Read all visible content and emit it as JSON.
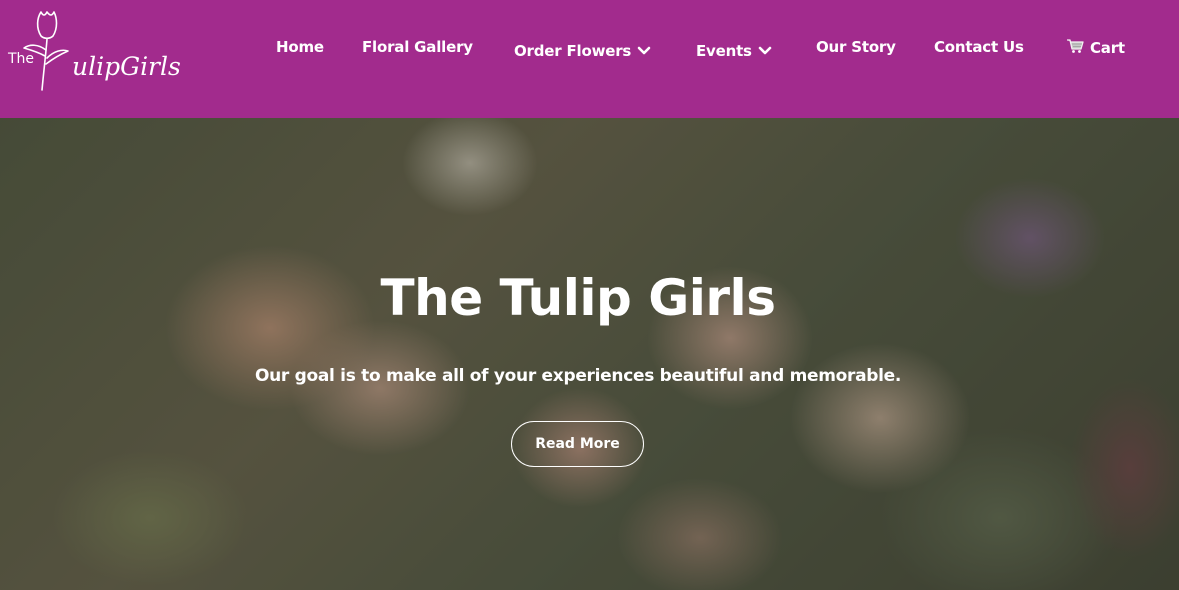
{
  "brand": {
    "logo_small": "The",
    "logo_big": "ulipGirls",
    "logo_icon": "tulip-logo-icon"
  },
  "nav": {
    "items": [
      {
        "label": "Home"
      },
      {
        "label": "Floral Gallery"
      },
      {
        "label": "Order Flowers",
        "icon": "chevron-down-icon"
      },
      {
        "label": "Events",
        "icon": "chevron-down-icon"
      },
      {
        "label": "Our Story"
      },
      {
        "label": "Contact Us"
      },
      {
        "label": "Cart",
        "icon": "shopping-cart-icon"
      }
    ]
  },
  "hero": {
    "title": "The Tulip Girls",
    "subtitle": "Our goal is to make all of your experiences beautiful and memorable.",
    "button_label": "Read More"
  },
  "colors": {
    "navbar_bg": "#a22b8d",
    "text": "#ffffff"
  }
}
